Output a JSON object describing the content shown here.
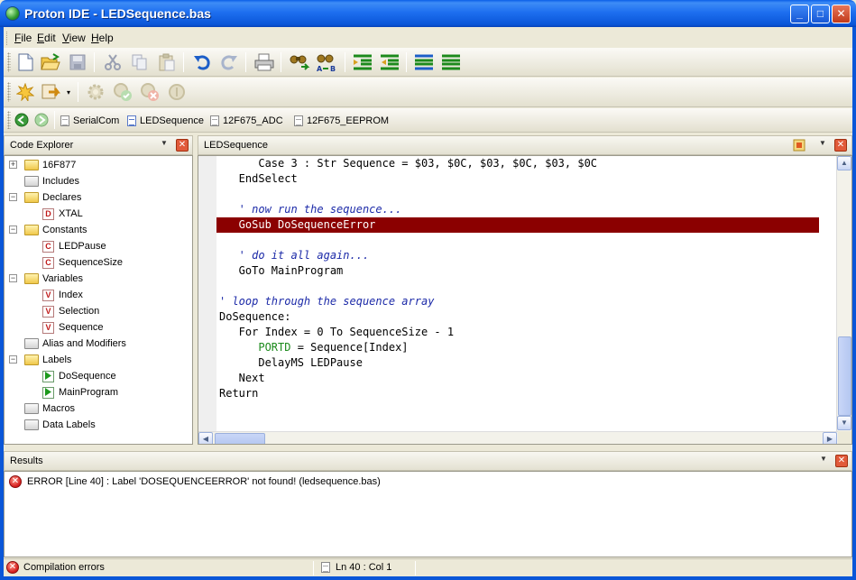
{
  "window": {
    "title": "Proton IDE - LEDSequence.bas"
  },
  "menu": [
    {
      "label": "File",
      "accel": "F",
      "rest": "ile"
    },
    {
      "label": "Edit",
      "accel": "E",
      "rest": "dit"
    },
    {
      "label": "View",
      "accel": "V",
      "rest": "iew"
    },
    {
      "label": "Help",
      "accel": "H",
      "rest": "elp"
    }
  ],
  "file_tabs": [
    "SerialCom",
    "LEDSequence",
    "12F675_ADC",
    "12F675_EEPROM"
  ],
  "code_explorer": {
    "title": "Code Explorer",
    "items": [
      {
        "label": "16F877",
        "type": "folder-yellow",
        "level": 0,
        "expander": "+"
      },
      {
        "label": "Includes",
        "type": "folder-gray",
        "level": 0
      },
      {
        "label": "Declares",
        "type": "folder-yellow",
        "level": 0,
        "expander": "-"
      },
      {
        "label": "XTAL",
        "type": "badge-D",
        "level": 1
      },
      {
        "label": "Constants",
        "type": "folder-yellow",
        "level": 0,
        "expander": "-"
      },
      {
        "label": "LEDPause",
        "type": "badge-C",
        "level": 1
      },
      {
        "label": "SequenceSize",
        "type": "badge-C",
        "level": 1
      },
      {
        "label": "Variables",
        "type": "folder-yellow",
        "level": 0,
        "expander": "-"
      },
      {
        "label": "Index",
        "type": "badge-V",
        "level": 1
      },
      {
        "label": "Selection",
        "type": "badge-V",
        "level": 1
      },
      {
        "label": "Sequence",
        "type": "badge-V",
        "level": 1
      },
      {
        "label": "Alias and Modifiers",
        "type": "folder-gray",
        "level": 0
      },
      {
        "label": "Labels",
        "type": "folder-yellow",
        "level": 0,
        "expander": "-"
      },
      {
        "label": "DoSequence",
        "type": "badge-label",
        "level": 1
      },
      {
        "label": "MainProgram",
        "type": "badge-label",
        "level": 1
      },
      {
        "label": "Macros",
        "type": "folder-gray",
        "level": 0
      },
      {
        "label": "Data Labels",
        "type": "folder-gray",
        "level": 0
      }
    ]
  },
  "editor": {
    "title": "LEDSequence",
    "lines": [
      {
        "text": "      Case 3 : Str Sequence = $03, $0C, $03, $0C, $03, $0C",
        "style": "kw"
      },
      {
        "text": "   EndSelect",
        "style": "kw"
      },
      {
        "text": "",
        "style": "kw"
      },
      {
        "text": "   ' now run the sequence...",
        "style": "cm"
      },
      {
        "text": "   GoSub DoSequenceError",
        "style": "hl"
      },
      {
        "text": "",
        "style": "kw"
      },
      {
        "text": "   ' do it all again...",
        "style": "cm"
      },
      {
        "text": "   GoTo MainProgram",
        "style": "kw"
      },
      {
        "text": "",
        "style": "kw"
      },
      {
        "text": "' loop through the sequence array",
        "style": "cm"
      },
      {
        "text": "DoSequence:",
        "style": "kw"
      },
      {
        "text": "   For Index = 0 To SequenceSize - 1",
        "style": "kw"
      },
      {
        "text": "      PORTD = Sequence[Index]",
        "style": "port"
      },
      {
        "text": "      DelayMS LEDPause",
        "style": "kw"
      },
      {
        "text": "   Next",
        "style": "kw"
      },
      {
        "text": "Return",
        "style": "kw"
      }
    ]
  },
  "results": {
    "title": "Results",
    "message": "ERROR [Line 40] : Label 'DOSEQUENCEERROR' not found! (ledsequence.bas)"
  },
  "status": {
    "state": "Compilation errors",
    "position": "Ln 40 : Col 1"
  }
}
